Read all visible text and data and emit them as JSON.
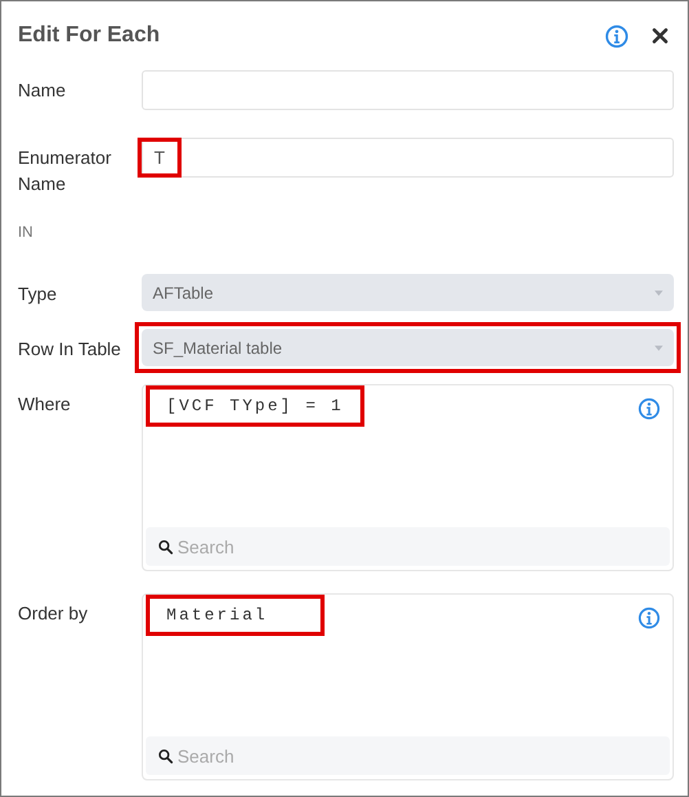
{
  "dialog": {
    "title": "Edit For Each"
  },
  "fields": [
    {
      "kind": "text",
      "label": "Name"
    },
    {
      "kind": "text",
      "label": "Enumerator Name",
      "value": "T",
      "highlighted": true
    },
    {
      "kind": "note",
      "text": "IN"
    },
    {
      "kind": "select",
      "label": "Type",
      "value": "AFTable",
      "highlighted": false
    },
    {
      "kind": "select",
      "label": "Row In Table",
      "value": "SF_Material table",
      "highlighted": true
    },
    {
      "kind": "editor",
      "label": "Where",
      "value": "[VCF TYpe] = 1",
      "highlighted": true,
      "search_placeholder": "Search"
    },
    {
      "kind": "editor",
      "label": "Order by",
      "value": "Material",
      "highlighted": true,
      "search_placeholder": "Search"
    }
  ]
}
